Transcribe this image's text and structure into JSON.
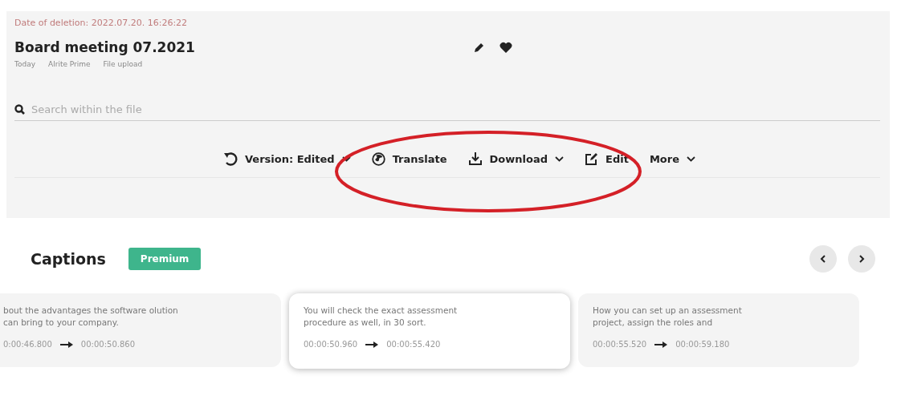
{
  "header": {
    "deletion_date": "Date of deletion: 2022.07.20. 16:26:22",
    "title": "Board meeting 07.2021",
    "meta": [
      "Today",
      "Alrite Prime",
      "File upload"
    ]
  },
  "search": {
    "placeholder": "Search within the file"
  },
  "toolbar": [
    {
      "kind": "version",
      "label": "Version: Edited",
      "dropdown": true
    },
    {
      "kind": "translate",
      "label": "Translate",
      "dropdown": false
    },
    {
      "kind": "download",
      "label": "Download",
      "dropdown": true
    },
    {
      "kind": "edit",
      "label": "Edit",
      "dropdown": false
    },
    {
      "kind": "more",
      "label": "More",
      "dropdown": true
    }
  ],
  "captions": {
    "title": "Captions",
    "badge": "Premium",
    "cards": [
      {
        "text": "bout the advantages the software olution can bring to your company.",
        "start": "0:00:46.800",
        "end": "00:00:50.860",
        "selected": false
      },
      {
        "text": "You will check the exact assessment procedure as well, in 30 sort.",
        "start": "00:00:50.960",
        "end": "00:00:55.420",
        "selected": true
      },
      {
        "text": "How you can set up an assessment project, assign the roles and",
        "start": "00:00:55.520",
        "end": "00:00:59.180",
        "selected": false
      }
    ]
  }
}
